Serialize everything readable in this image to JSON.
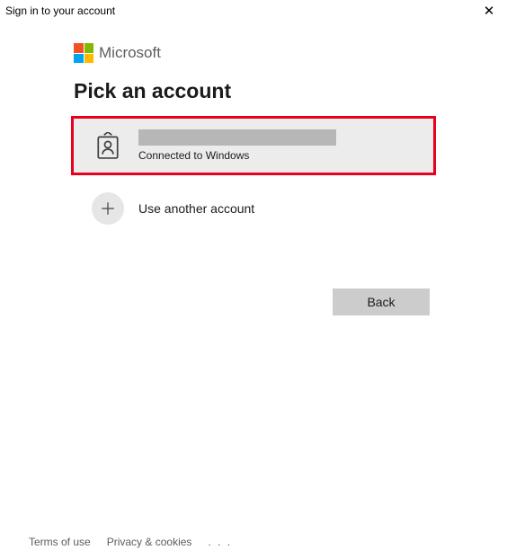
{
  "titlebar": {
    "title": "Sign in to your account"
  },
  "brand": {
    "name": "Microsoft"
  },
  "heading": "Pick an account",
  "accounts": {
    "primary_sub": "Connected to Windows",
    "other_label": "Use another account"
  },
  "actions": {
    "back": "Back"
  },
  "footer": {
    "terms": "Terms of use",
    "privacy": "Privacy & cookies",
    "more": ". . ."
  }
}
